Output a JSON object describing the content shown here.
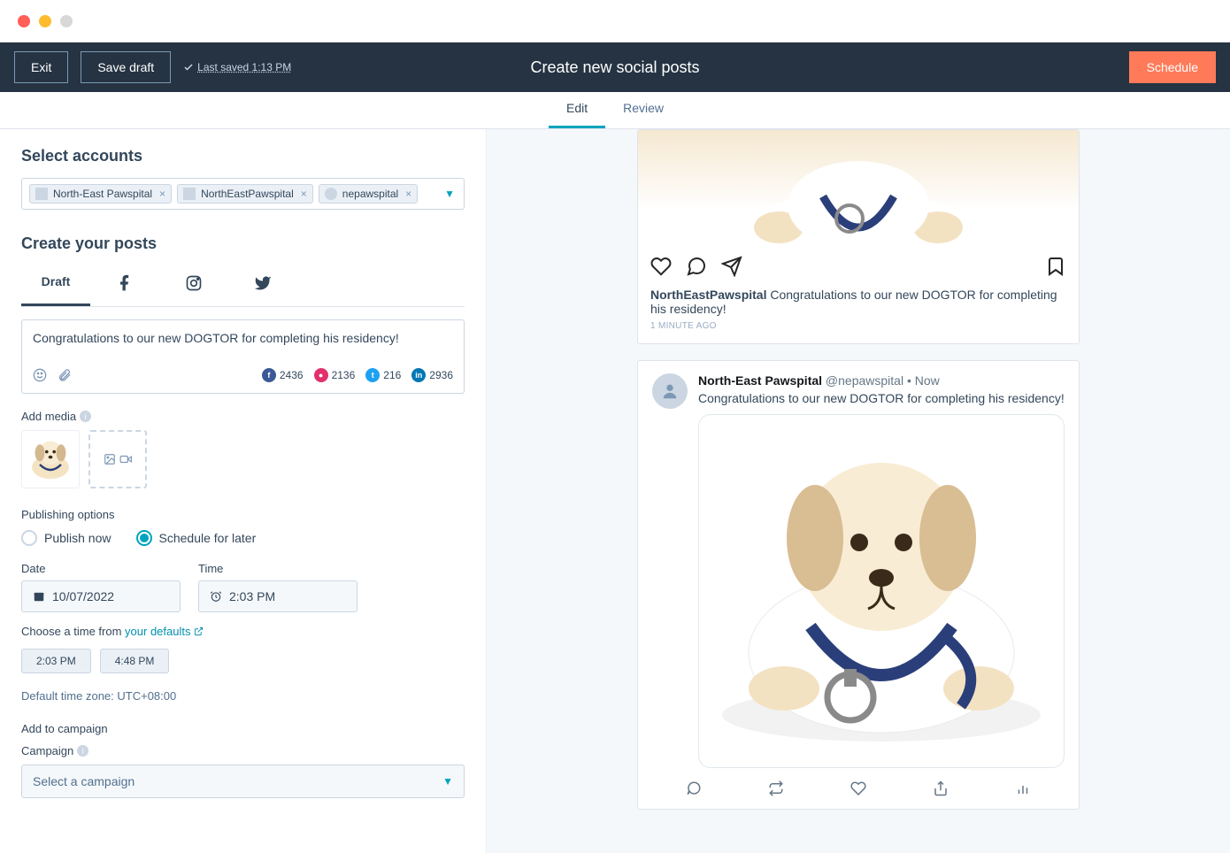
{
  "chrome": {},
  "topbar": {
    "exit": "Exit",
    "save_draft": "Save draft",
    "last_saved": "Last saved 1:13 PM",
    "title": "Create new social posts",
    "schedule": "Schedule"
  },
  "tabs": {
    "edit": "Edit",
    "review": "Review"
  },
  "left": {
    "select_accounts_title": "Select accounts",
    "accounts": [
      {
        "label": "North-East Pawspital"
      },
      {
        "label": "NorthEastPawspital"
      },
      {
        "label": "nepawspital"
      }
    ],
    "create_posts_title": "Create your posts",
    "post_tabs": {
      "draft": "Draft"
    },
    "composer_text": "Congratulations to our new DOGTOR for completing his residency!",
    "counts": {
      "fb": "2436",
      "ig": "2136",
      "tw": "216",
      "li": "2936"
    },
    "add_media_label": "Add media",
    "publishing_label": "Publishing options",
    "publish_now": "Publish now",
    "schedule_later": "Schedule for later",
    "date_label": "Date",
    "date_value": "10/07/2022",
    "time_label": "Time",
    "time_value": "2:03 PM",
    "defaults_prefix": "Choose a time from ",
    "defaults_link": "your defaults",
    "time_options": [
      "2:03 PM",
      "4:48 PM"
    ],
    "tz": "Default time zone: UTC+08:00",
    "add_campaign_label": "Add to campaign",
    "campaign_label": "Campaign",
    "campaign_placeholder": "Select a campaign"
  },
  "preview": {
    "ig": {
      "username": "NorthEastPawspital",
      "caption": "Congratulations to our new DOGTOR for completing his residency!",
      "time": "1 MINUTE AGO"
    },
    "tw": {
      "name": "North-East Pawspital",
      "handle": "@nepawspital",
      "time": "Now",
      "text": "Congratulations to our new DOGTOR for completing his residency!"
    }
  }
}
